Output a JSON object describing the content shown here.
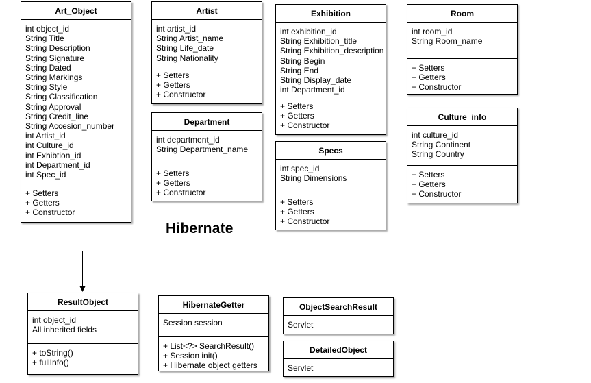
{
  "section_label": "Hibernate",
  "classes": {
    "art_object": {
      "name": "Art_Object",
      "attributes": [
        "int object_id",
        "String Title",
        "String Description",
        "String Signature",
        "String Dated",
        "String Markings",
        "String Style",
        "String Classification",
        "String Approval",
        "String Credit_line",
        "String Accesion_number",
        "int Artist_id",
        "int Culture_id",
        "int Exhibtion_id",
        "int Department_id",
        "int Spec_id"
      ],
      "methods": [
        "+ Setters",
        "+ Getters",
        "+ Constructor"
      ]
    },
    "artist": {
      "name": "Artist",
      "attributes": [
        "int artist_id",
        "String Artist_name",
        "String Life_date",
        "String Nationality"
      ],
      "methods": [
        "+ Setters",
        "+ Getters",
        "+ Constructor"
      ]
    },
    "department": {
      "name": "Department",
      "attributes": [
        "int department_id",
        "String Department_name"
      ],
      "methods": [
        "+ Setters",
        "+ Getters",
        "+ Constructor"
      ]
    },
    "exhibition": {
      "name": "Exhibition",
      "attributes": [
        "int exhibition_id",
        "String Exhibition_title",
        "String Exhibition_description",
        "String Begin",
        "String End",
        "String Display_date",
        "int Department_id"
      ],
      "methods": [
        "+ Setters",
        "+ Getters",
        "+ Constructor"
      ]
    },
    "specs": {
      "name": "Specs",
      "attributes": [
        "int spec_id",
        "String Dimensions"
      ],
      "methods": [
        "+ Setters",
        "+ Getters",
        "+ Constructor"
      ]
    },
    "room": {
      "name": "Room",
      "attributes": [
        "int room_id",
        "String Room_name"
      ],
      "methods": [
        "+ Setters",
        "+ Getters",
        "+ Constructor"
      ]
    },
    "culture_info": {
      "name": "Culture_info",
      "attributes": [
        "int culture_id",
        "String Continent",
        "String Country"
      ],
      "methods": [
        "+ Setters",
        "+ Getters",
        "+ Constructor"
      ]
    },
    "result_object": {
      "name": "ResultObject",
      "attributes": [
        "int object_id",
        "All inherited fields"
      ],
      "methods": [
        "+ toString()",
        "+ fullInfo()"
      ]
    },
    "hibernate_getter": {
      "name": "HibernateGetter",
      "attributes": [
        "Session session"
      ],
      "methods": [
        "+ List<?> SearchResult()",
        "+ Session init()",
        "+ Hibernate object getters"
      ]
    },
    "object_search_result": {
      "name": "ObjectSearchResult",
      "attributes": [
        "Servlet"
      ],
      "methods": []
    },
    "detailed_object": {
      "name": "DetailedObject",
      "attributes": [
        "Servlet"
      ],
      "methods": []
    }
  }
}
